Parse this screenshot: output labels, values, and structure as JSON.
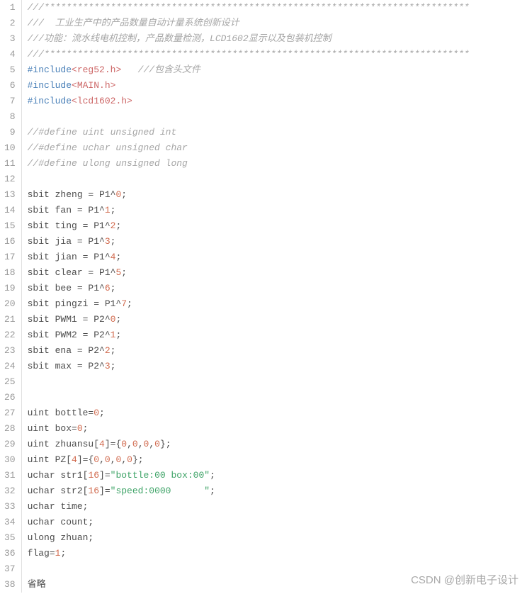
{
  "watermark": "CSDN @创新电子设计",
  "lines": [
    {
      "n": 1,
      "tokens": [
        {
          "cls": "comment",
          "t": "///*****************************************************************************"
        }
      ]
    },
    {
      "n": 2,
      "tokens": [
        {
          "cls": "comment",
          "t": "///  工业生产中的产品数量自动计量系统创新设计"
        }
      ]
    },
    {
      "n": 3,
      "tokens": [
        {
          "cls": "comment",
          "t": "///功能：流水线电机控制，产品数量检测，LCD1602显示以及包装机控制"
        }
      ]
    },
    {
      "n": 4,
      "tokens": [
        {
          "cls": "comment",
          "t": "///*****************************************************************************"
        }
      ]
    },
    {
      "n": 5,
      "tokens": [
        {
          "cls": "keyword",
          "t": "#include"
        },
        {
          "cls": "include-brk",
          "t": "<reg52.h>"
        },
        {
          "cls": "",
          "t": "   "
        },
        {
          "cls": "comment",
          "t": "///包含头文件"
        }
      ]
    },
    {
      "n": 6,
      "tokens": [
        {
          "cls": "keyword",
          "t": "#include"
        },
        {
          "cls": "include-brk",
          "t": "<MAIN.h>"
        }
      ]
    },
    {
      "n": 7,
      "tokens": [
        {
          "cls": "keyword",
          "t": "#include"
        },
        {
          "cls": "include-brk",
          "t": "<lcd1602.h>"
        }
      ]
    },
    {
      "n": 8,
      "tokens": []
    },
    {
      "n": 9,
      "tokens": [
        {
          "cls": "comment",
          "t": "//#define uint unsigned int"
        }
      ]
    },
    {
      "n": 10,
      "tokens": [
        {
          "cls": "comment",
          "t": "//#define uchar unsigned char"
        }
      ]
    },
    {
      "n": 11,
      "tokens": [
        {
          "cls": "comment",
          "t": "//#define ulong unsigned long"
        }
      ]
    },
    {
      "n": 12,
      "tokens": []
    },
    {
      "n": 13,
      "tokens": [
        {
          "cls": "",
          "t": "sbit zheng = P1^"
        },
        {
          "cls": "number",
          "t": "0"
        },
        {
          "cls": "",
          "t": ";"
        }
      ]
    },
    {
      "n": 14,
      "tokens": [
        {
          "cls": "",
          "t": "sbit fan = P1^"
        },
        {
          "cls": "number",
          "t": "1"
        },
        {
          "cls": "",
          "t": ";"
        }
      ]
    },
    {
      "n": 15,
      "tokens": [
        {
          "cls": "",
          "t": "sbit ting = P1^"
        },
        {
          "cls": "number",
          "t": "2"
        },
        {
          "cls": "",
          "t": ";"
        }
      ]
    },
    {
      "n": 16,
      "tokens": [
        {
          "cls": "",
          "t": "sbit jia = P1^"
        },
        {
          "cls": "number",
          "t": "3"
        },
        {
          "cls": "",
          "t": ";"
        }
      ]
    },
    {
      "n": 17,
      "tokens": [
        {
          "cls": "",
          "t": "sbit jian = P1^"
        },
        {
          "cls": "number",
          "t": "4"
        },
        {
          "cls": "",
          "t": ";"
        }
      ]
    },
    {
      "n": 18,
      "tokens": [
        {
          "cls": "",
          "t": "sbit clear = P1^"
        },
        {
          "cls": "number",
          "t": "5"
        },
        {
          "cls": "",
          "t": ";"
        }
      ]
    },
    {
      "n": 19,
      "tokens": [
        {
          "cls": "",
          "t": "sbit bee = P1^"
        },
        {
          "cls": "number",
          "t": "6"
        },
        {
          "cls": "",
          "t": ";"
        }
      ]
    },
    {
      "n": 20,
      "tokens": [
        {
          "cls": "",
          "t": "sbit pingzi = P1^"
        },
        {
          "cls": "number",
          "t": "7"
        },
        {
          "cls": "",
          "t": ";"
        }
      ]
    },
    {
      "n": 21,
      "tokens": [
        {
          "cls": "",
          "t": "sbit PWM1 = P2^"
        },
        {
          "cls": "number",
          "t": "0"
        },
        {
          "cls": "",
          "t": ";"
        }
      ]
    },
    {
      "n": 22,
      "tokens": [
        {
          "cls": "",
          "t": "sbit PWM2 = P2^"
        },
        {
          "cls": "number",
          "t": "1"
        },
        {
          "cls": "",
          "t": ";"
        }
      ]
    },
    {
      "n": 23,
      "tokens": [
        {
          "cls": "",
          "t": "sbit ena = P2^"
        },
        {
          "cls": "number",
          "t": "2"
        },
        {
          "cls": "",
          "t": ";"
        }
      ]
    },
    {
      "n": 24,
      "tokens": [
        {
          "cls": "",
          "t": "sbit max = P2^"
        },
        {
          "cls": "number",
          "t": "3"
        },
        {
          "cls": "",
          "t": ";"
        }
      ]
    },
    {
      "n": 25,
      "tokens": []
    },
    {
      "n": 26,
      "tokens": []
    },
    {
      "n": 27,
      "tokens": [
        {
          "cls": "",
          "t": "uint bottle="
        },
        {
          "cls": "number",
          "t": "0"
        },
        {
          "cls": "",
          "t": ";"
        }
      ]
    },
    {
      "n": 28,
      "tokens": [
        {
          "cls": "",
          "t": "uint box="
        },
        {
          "cls": "number",
          "t": "0"
        },
        {
          "cls": "",
          "t": ";"
        }
      ]
    },
    {
      "n": 29,
      "tokens": [
        {
          "cls": "",
          "t": "uint zhuansu["
        },
        {
          "cls": "number",
          "t": "4"
        },
        {
          "cls": "",
          "t": "]={"
        },
        {
          "cls": "number",
          "t": "0"
        },
        {
          "cls": "",
          "t": ","
        },
        {
          "cls": "number",
          "t": "0"
        },
        {
          "cls": "",
          "t": ","
        },
        {
          "cls": "number",
          "t": "0"
        },
        {
          "cls": "",
          "t": ","
        },
        {
          "cls": "number",
          "t": "0"
        },
        {
          "cls": "",
          "t": "};"
        }
      ]
    },
    {
      "n": 30,
      "tokens": [
        {
          "cls": "",
          "t": "uint PZ["
        },
        {
          "cls": "number",
          "t": "4"
        },
        {
          "cls": "",
          "t": "]={"
        },
        {
          "cls": "number",
          "t": "0"
        },
        {
          "cls": "",
          "t": ","
        },
        {
          "cls": "number",
          "t": "0"
        },
        {
          "cls": "",
          "t": ","
        },
        {
          "cls": "number",
          "t": "0"
        },
        {
          "cls": "",
          "t": ","
        },
        {
          "cls": "number",
          "t": "0"
        },
        {
          "cls": "",
          "t": "};"
        }
      ]
    },
    {
      "n": 31,
      "tokens": [
        {
          "cls": "",
          "t": "uchar str1["
        },
        {
          "cls": "number",
          "t": "16"
        },
        {
          "cls": "",
          "t": "]="
        },
        {
          "cls": "string",
          "t": "\"bottle:00 box:00\""
        },
        {
          "cls": "",
          "t": ";"
        }
      ]
    },
    {
      "n": 32,
      "tokens": [
        {
          "cls": "",
          "t": "uchar str2["
        },
        {
          "cls": "number",
          "t": "16"
        },
        {
          "cls": "",
          "t": "]="
        },
        {
          "cls": "string",
          "t": "\"speed:0000      \""
        },
        {
          "cls": "",
          "t": ";"
        }
      ]
    },
    {
      "n": 33,
      "tokens": [
        {
          "cls": "",
          "t": "uchar time;"
        }
      ]
    },
    {
      "n": 34,
      "tokens": [
        {
          "cls": "",
          "t": "uchar count;"
        }
      ]
    },
    {
      "n": 35,
      "tokens": [
        {
          "cls": "",
          "t": "ulong zhuan;"
        }
      ]
    },
    {
      "n": 36,
      "tokens": [
        {
          "cls": "",
          "t": "flag="
        },
        {
          "cls": "number",
          "t": "1"
        },
        {
          "cls": "",
          "t": ";"
        }
      ]
    },
    {
      "n": 37,
      "tokens": []
    },
    {
      "n": 38,
      "tokens": [
        {
          "cls": "",
          "t": "省略"
        }
      ]
    }
  ]
}
